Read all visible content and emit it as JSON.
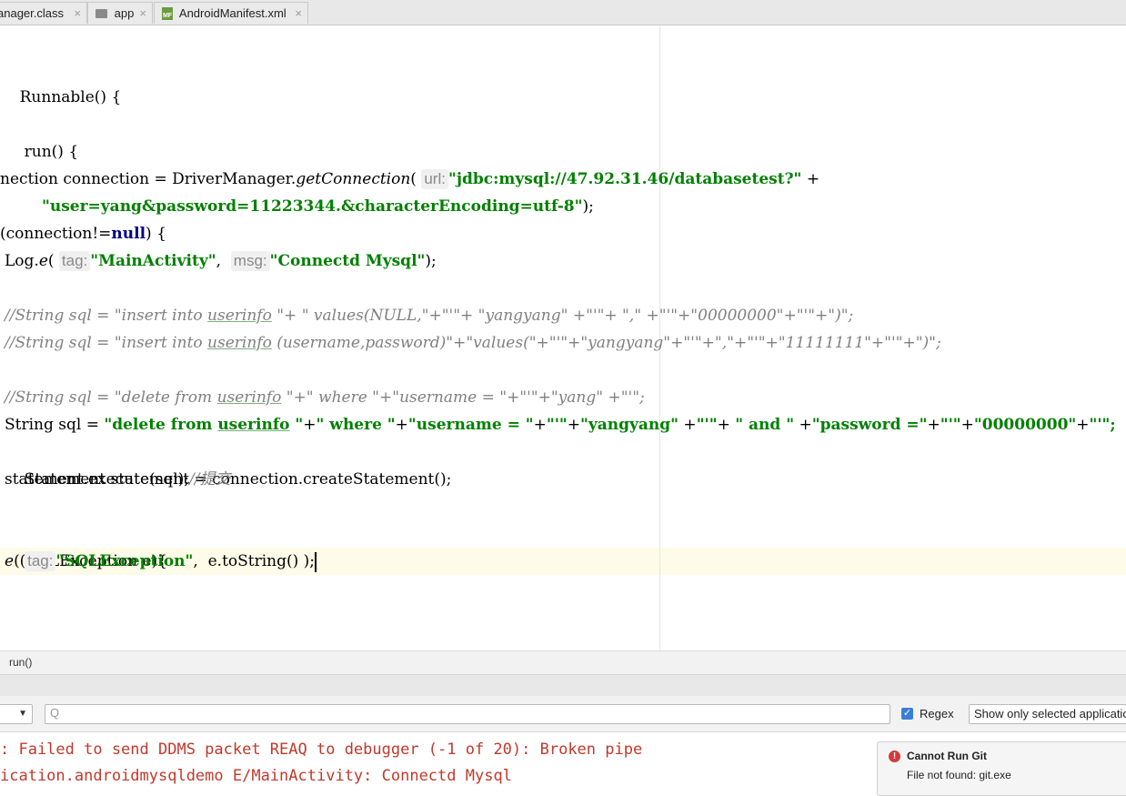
{
  "tabs": [
    {
      "label": "anager.class",
      "close": "×"
    },
    {
      "label": "app",
      "close": "×"
    },
    {
      "label": "AndroidManifest.xml",
      "icon_text": "MF",
      "close": "×"
    }
  ],
  "editor": {
    "l1": "Runnable() {",
    "l2": "run() {",
    "l3a": "nection connection = DriverManager.",
    "l3b": "getConnection",
    "l3c": "(",
    "l3hint": "url:",
    "l3str": "\"jdbc:mysql://47.92.31.46/databasetest?\"",
    "l3end": " +",
    "l4str": "\"user=yang&password=11223344.&characterEncoding=utf-8\"",
    "l4end": ");",
    "l5a": "(connection!=",
    "l5kw": "null",
    "l5b": ") {",
    "l6a": "Log.",
    "l6b": "e",
    "l6c": "(",
    "l6hint1": "tag:",
    "l6str1": "\"MainActivity\"",
    "l6d": ",  ",
    "l6hint2": "msg:",
    "l6str2": "\"Connectd Mysql\"",
    "l6e": ");",
    "l7a": "//String sql = \"insert into ",
    "l7u": "userinfo",
    "l7b": " \"+ \" values(NULL,\"+\"'\"+ \"yangyang\" +\"'\"+ \",\" +\"'\"+\"00000000\"+\"'\"+\")\";",
    "l8a": "//String sql = \"insert into ",
    "l8u": "userinfo",
    "l8b": " (username,password)\"+\"values(\"+\"'\"+\"yangyang\"+\"'\"+\",\"+\"'\"+\"11111111\"+\"'\"+\")\";",
    "l9a": "//String sql = \"delete from ",
    "l9u": "userinfo",
    "l9b": " \"+\" where \"+\"username = \"+\"'\"+\"yang\" +\"'\";",
    "l10a": "String sql = ",
    "l10s1": "\"delete from ",
    "l10u": "userinfo",
    "l10s2": " \"",
    "l10b": "+",
    "l10s3": "\" where \"",
    "l10c": "+",
    "l10s4": "\"username = \"",
    "l10d": "+",
    "l10s5": "\"'\"",
    "l10e": "+",
    "l10s6": "\"yangyang\"",
    "l10f": " +",
    "l10s7": "\"'\"",
    "l10g": "+ ",
    "l10s8": "\" and \"",
    "l10h": " +",
    "l10s9": "\"password =\"",
    "l10i": "+",
    "l10s10": "\"'\"",
    "l10j": "+",
    "l10s11": "\"00000000\"",
    "l10k": "+",
    "l10s12": "\"'\";",
    "l11": "Statement statement = connection.createStatement();",
    "l12a": "statement.execute(sql);",
    "l12c": "//提交",
    "l13": "(SQLException e){",
    "l14a": "e",
    "l14b": "(",
    "l14hint": "tag:",
    "l14str": "\"SQLException\"",
    "l14c": ",  e.toString() );"
  },
  "breadcrumb": "run()",
  "logcat": {
    "search_placeholder": "",
    "search_icon": "Q",
    "regex_label": "Regex",
    "filter_label": "Show only selected application",
    "lines": [
      ": Failed to send DDMS packet REAQ to debugger (-1 of 20): Broken pipe",
      "ication.androidmysqldemo E/MainActivity: Connectd Mysql"
    ]
  },
  "notification": {
    "title": "Cannot Run Git",
    "body": "File not found: git.exe"
  }
}
